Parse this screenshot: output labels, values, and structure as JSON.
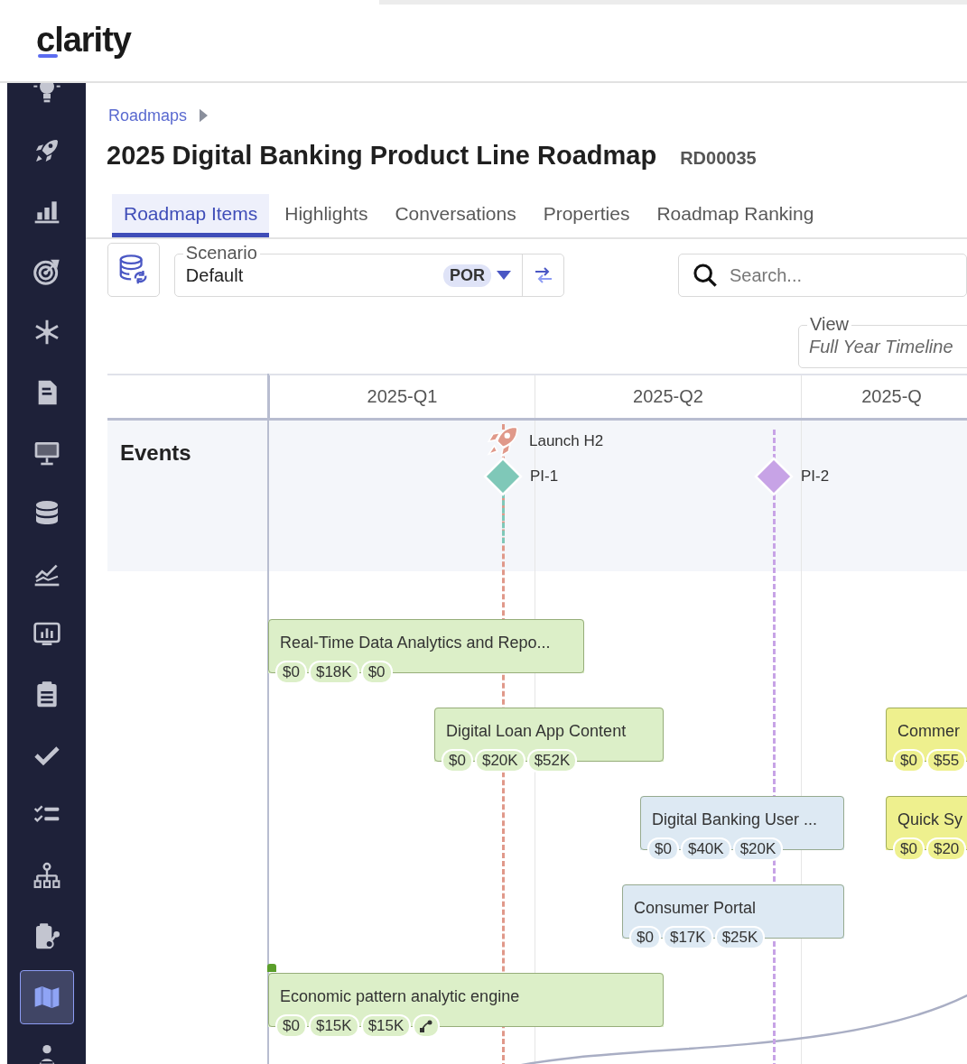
{
  "logo": {
    "text": "clarity"
  },
  "sidebar": {
    "items": [
      {
        "selected": false
      },
      {
        "selected": false
      },
      {
        "selected": false
      },
      {
        "selected": false
      },
      {
        "selected": false
      },
      {
        "selected": false
      },
      {
        "selected": false
      },
      {
        "selected": false
      },
      {
        "selected": false
      },
      {
        "selected": false
      },
      {
        "selected": false
      },
      {
        "selected": false
      },
      {
        "selected": false
      },
      {
        "selected": false
      },
      {
        "selected": false
      },
      {
        "selected": true
      },
      {
        "selected": false
      }
    ]
  },
  "breadcrumb": {
    "items": [
      "Roadmaps"
    ]
  },
  "header": {
    "title": "2025 Digital Banking Product Line Roadmap",
    "code": "RD00035"
  },
  "tabs": [
    {
      "label": "Roadmap Items",
      "selected": true
    },
    {
      "label": "Highlights",
      "selected": false
    },
    {
      "label": "Conversations",
      "selected": false
    },
    {
      "label": "Properties",
      "selected": false
    },
    {
      "label": "Roadmap Ranking",
      "selected": false
    }
  ],
  "toolbar": {
    "scenario": {
      "label": "Scenario",
      "value": "Default",
      "badge": "POR"
    },
    "search": {
      "placeholder": "Search..."
    },
    "view": {
      "label": "View",
      "value": "Full Year Timeline"
    }
  },
  "timeline": {
    "columns": [
      "2025-Q1",
      "2025-Q2",
      "2025-Q"
    ],
    "events_label": "Events",
    "events": [
      {
        "kind": "rocket",
        "label": "Launch H2",
        "color": "#e0998a"
      },
      {
        "kind": "milestone",
        "label": "PI-1",
        "color": "#7fc8b8"
      },
      {
        "kind": "milestone",
        "label": "PI-2",
        "color": "#c7a3e6"
      }
    ],
    "items": [
      {
        "title": "Real-Time Data Analytics and Repo...",
        "costs": [
          "$0",
          "$18K",
          "$0"
        ],
        "color": "#dcefc8"
      },
      {
        "title": "Digital Loan App Content",
        "costs": [
          "$0",
          "$20K",
          "$52K"
        ],
        "color": "#dcefc8"
      },
      {
        "title": "Commer",
        "costs": [
          "$0",
          "$55"
        ],
        "color": "#eef08e"
      },
      {
        "title": "Digital Banking User ...",
        "costs": [
          "$0",
          "$40K",
          "$20K"
        ],
        "color": "#dde9f3"
      },
      {
        "title": "Quick Sy",
        "costs": [
          "$0",
          "$20"
        ],
        "color": "#eef08e"
      },
      {
        "title": "Consumer Portal",
        "costs": [
          "$0",
          "$17K",
          "$25K"
        ],
        "color": "#dde9f3"
      },
      {
        "title": "Economic pattern analytic engine",
        "costs": [
          "$0",
          "$15K",
          "$15K"
        ],
        "color": "#dcefc8",
        "flagged": true,
        "dependency": true
      }
    ]
  }
}
